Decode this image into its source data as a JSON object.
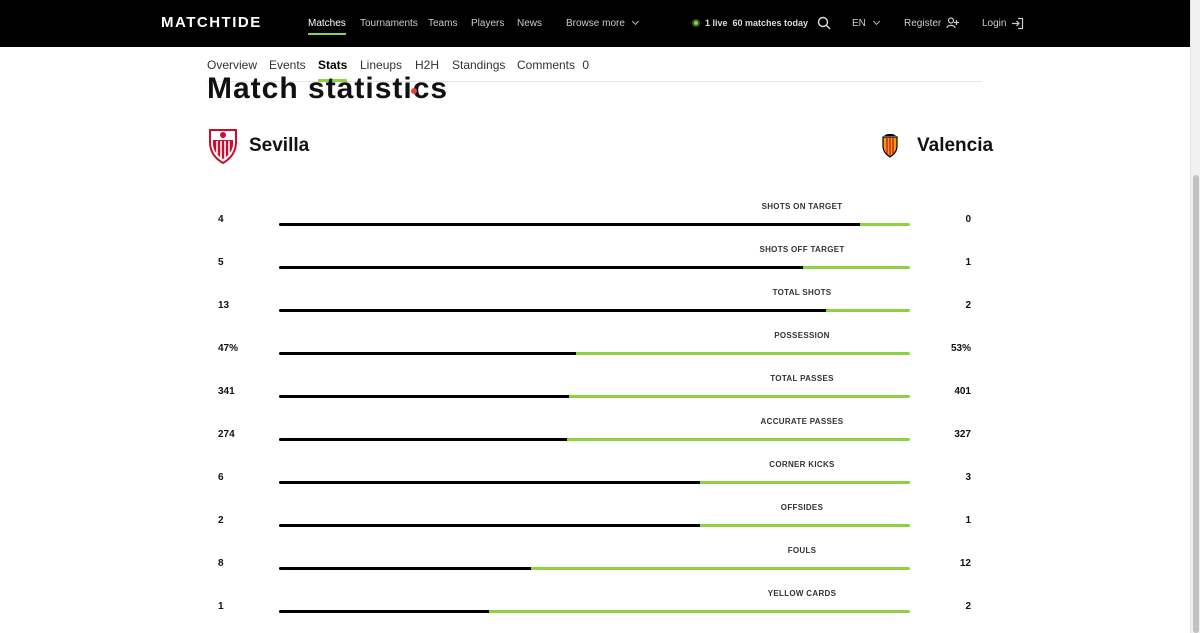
{
  "header": {
    "logo": "MATCHTIDE",
    "nav": [
      {
        "label": "Matches",
        "active": true
      },
      {
        "label": "Tournaments",
        "active": false
      },
      {
        "label": "Teams",
        "active": false
      },
      {
        "label": "Players",
        "active": false
      },
      {
        "label": "News",
        "active": false
      },
      {
        "label": "Browse more",
        "active": false
      }
    ],
    "live_count": "1 live",
    "matches_today": "60 matches today",
    "language": "EN",
    "register": "Register",
    "login": "Login"
  },
  "tabs": [
    {
      "label": "Overview",
      "active": false
    },
    {
      "label": "Events",
      "active": false
    },
    {
      "label": "Stats",
      "active": true
    },
    {
      "label": "Lineups",
      "active": false
    },
    {
      "label": "H2H",
      "active": false
    },
    {
      "label": "Standings",
      "active": false
    },
    {
      "label": "Comments",
      "active": false,
      "count": "0"
    }
  ],
  "page_title": "Match statistics",
  "home_team": {
    "name": "Sevilla",
    "logo": "sevilla-crest-icon"
  },
  "away_team": {
    "name": "Valencia",
    "logo": "valencia-crest-icon"
  },
  "colors": {
    "accent": "#8fd13f",
    "home_bar": "#000000",
    "live_dot": "#8fd13f",
    "title_dot": "#e4423a"
  },
  "stats": [
    {
      "label": "SHOTS ON TARGET",
      "home": "4",
      "away": "0",
      "home_share": 0.92
    },
    {
      "label": "SHOTS OFF TARGET",
      "home": "5",
      "away": "1",
      "home_share": 0.83
    },
    {
      "label": "TOTAL SHOTS",
      "home": "13",
      "away": "2",
      "home_share": 0.867
    },
    {
      "label": "POSSESSION",
      "home": "47%",
      "away": "53%",
      "home_share": 0.47
    },
    {
      "label": "TOTAL PASSES",
      "home": "341",
      "away": "401",
      "home_share": 0.46
    },
    {
      "label": "ACCURATE PASSES",
      "home": "274",
      "away": "327",
      "home_share": 0.456
    },
    {
      "label": "CORNER KICKS",
      "home": "6",
      "away": "3",
      "home_share": 0.667
    },
    {
      "label": "OFFSIDES",
      "home": "2",
      "away": "1",
      "home_share": 0.667
    },
    {
      "label": "FOULS",
      "home": "8",
      "away": "12",
      "home_share": 0.4
    },
    {
      "label": "YELLOW CARDS",
      "home": "1",
      "away": "2",
      "home_share": 0.333
    }
  ]
}
